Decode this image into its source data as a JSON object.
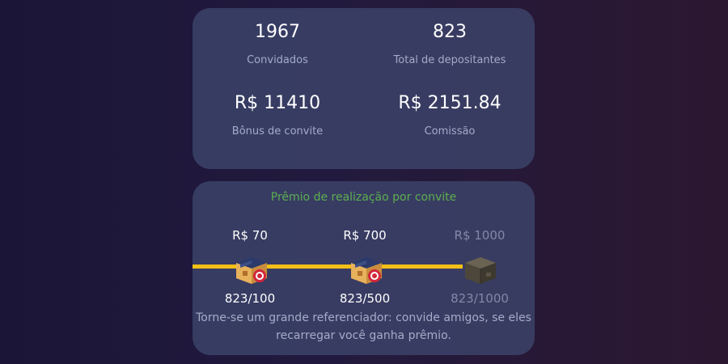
{
  "stats": {
    "invited": {
      "value": "1967",
      "label": "Convidados"
    },
    "depositors": {
      "value": "823",
      "label": "Total de depositantes"
    },
    "bonus": {
      "value": "R$ 11410",
      "label": "Bônus de convite"
    },
    "commission": {
      "value": "R$ 2151.84",
      "label": "Comissão"
    }
  },
  "achievements": {
    "title": "Prêmio de realização por convite",
    "progress_fraction": 0.79,
    "milestones": [
      {
        "reward": "R$ 70",
        "count": "823/100",
        "icon": "chest-reward-icon",
        "achieved": true
      },
      {
        "reward": "R$ 700",
        "count": "823/500",
        "icon": "chest-reward-icon",
        "achieved": true
      },
      {
        "reward": "R$ 1000",
        "count": "823/1000",
        "icon": "box-locked-icon",
        "achieved": false
      }
    ],
    "description": "Torne-se um grande referenciador: convide amigos, se eles recarregar você ganha prêmio."
  },
  "colors": {
    "accent_progress": "#f3bf16",
    "title_green": "#5cae4e",
    "card_bg": "#46527a"
  }
}
